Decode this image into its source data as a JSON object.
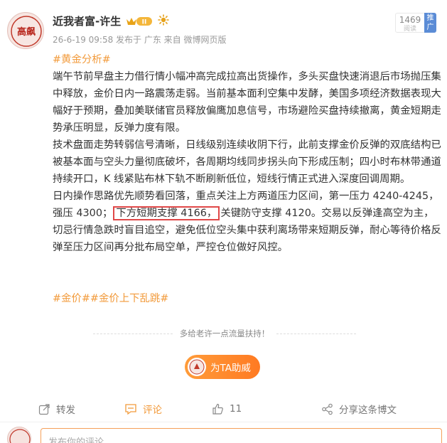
{
  "author": {
    "name": "近我者富-许生",
    "avatar_text": "高飙",
    "vip_level": "II",
    "meta": "26-6-19 09:58 发布于 广东 来自 微博网页版"
  },
  "read": {
    "count": "1469",
    "label": "阅读"
  },
  "promote": {
    "label": "推广"
  },
  "post": {
    "topic": "#黄金分析#",
    "p1": "端午节前早盘主力借行情小幅冲高完成拉高出货操作，多头买盘快速消退后市场抛压集中释放，金价日内一路震荡走弱。当前基本面利空集中发酵，美国多项经济数据表现大幅好于预期，叠加美联储官员释放偏鹰加息信号，市场避险买盘持续撤离，黄金短期走势承压明显，反弹力度有限。",
    "p2": "技术盘面走势转弱信号清晰，日线级别连续收阴下行，此前支撑金价反弹的双底结构已被基本面与空头力量彻底破坏，各周期均线同步拐头向下形成压制；四小时布林带通道持续开口，K 线紧贴布林下轨不断刷新低位，短线行情正式进入深度回调周期。",
    "p3_before": "日内操作思路优先顺势看回落，重点关注上方两道压力区间，第一压力 4240-4245，强压 4300；",
    "p3_highlight": "下方短期支撑 4166，",
    "p3_after": "关键防守支撑 4120。交易以反弹逢高空为主，切忌行情急跌时盲目追空，避免低位空头集中获利离场带来短期反弹，耐心等待价格反弹至压力区间再分批布局空单，严控仓位做好风控。",
    "tags": "#金价##金价上下乱跳#"
  },
  "support": {
    "text": "多给老许一点流量扶持！"
  },
  "boost": {
    "label": "为TA助威"
  },
  "actions": {
    "repost": "转发",
    "comment": "评论",
    "like_count": "11",
    "share": "分享这条博文"
  },
  "comment_input": {
    "placeholder": "发布你的评论"
  },
  "colors": {
    "topic": "#f29a3a",
    "highlight_border": "#e04848",
    "boost_start": "#ff9c3a",
    "boost_end": "#ff7a22",
    "promote": "#5b8cd6"
  }
}
